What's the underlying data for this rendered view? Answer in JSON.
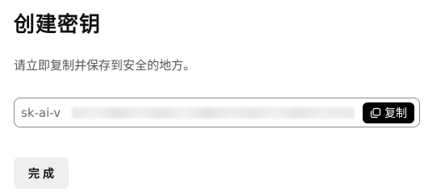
{
  "dialog": {
    "title": "创建密钥",
    "description": "请立即复制并保存到安全的地方。",
    "key_prefix": "sk-ai-v",
    "copy_label": "复制",
    "copy_icon": "copy-icon",
    "done_label": "完成"
  }
}
